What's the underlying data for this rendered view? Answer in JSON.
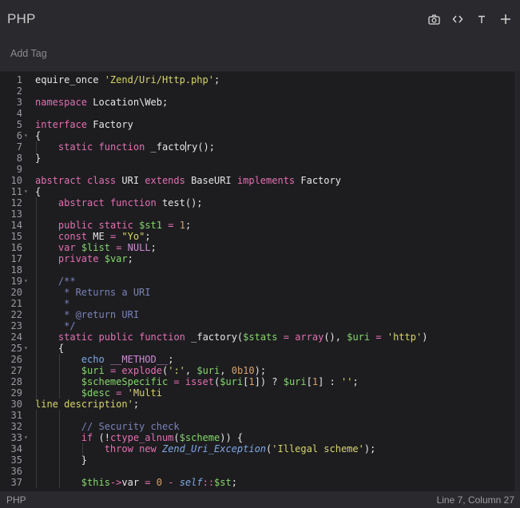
{
  "header": {
    "title": "PHP",
    "icons": [
      "camera-icon",
      "code-brackets-icon",
      "text-format-icon",
      "plus-icon"
    ]
  },
  "tags": {
    "add_label": "Add Tag"
  },
  "colors": {
    "keyword": "#e46fb1",
    "string": "#d7d46c",
    "number": "#d8a06a",
    "variable": "#86d66b",
    "comment": "#7a83b8",
    "magic": "#7fa8e6",
    "constant": "#d08ad6",
    "plain": "#e6e6e6"
  },
  "editor": {
    "lines": [
      {
        "n": "1",
        "fold": false,
        "indent": 0,
        "tokens": [
          [
            "p",
            "equire_once "
          ],
          [
            "s",
            "'Zend/Uri/Http.php'"
          ],
          [
            "p",
            ";"
          ]
        ]
      },
      {
        "n": "2",
        "fold": false,
        "indent": 0,
        "tokens": []
      },
      {
        "n": "3",
        "fold": false,
        "indent": 0,
        "tokens": [
          [
            "k",
            "namespace"
          ],
          [
            "p",
            " Location\\Web;"
          ]
        ]
      },
      {
        "n": "4",
        "fold": false,
        "indent": 0,
        "tokens": []
      },
      {
        "n": "5",
        "fold": false,
        "indent": 0,
        "tokens": [
          [
            "k",
            "interface"
          ],
          [
            "p",
            " Factory"
          ]
        ]
      },
      {
        "n": "6",
        "fold": true,
        "indent": 0,
        "tokens": [
          [
            "p",
            "{"
          ]
        ]
      },
      {
        "n": "7",
        "fold": false,
        "indent": 1,
        "tokens": [
          [
            "p",
            "    "
          ],
          [
            "k",
            "static"
          ],
          [
            "p",
            " "
          ],
          [
            "k",
            "function"
          ],
          [
            "p",
            " _facto"
          ],
          [
            "cursor",
            ""
          ],
          [
            "p",
            "ry();"
          ]
        ]
      },
      {
        "n": "8",
        "fold": false,
        "indent": 0,
        "tokens": [
          [
            "p",
            "}"
          ]
        ]
      },
      {
        "n": "9",
        "fold": false,
        "indent": 0,
        "tokens": []
      },
      {
        "n": "10",
        "fold": false,
        "indent": 0,
        "tokens": [
          [
            "k",
            "abstract"
          ],
          [
            "p",
            " "
          ],
          [
            "k",
            "class"
          ],
          [
            "p",
            " URI "
          ],
          [
            "k",
            "extends"
          ],
          [
            "p",
            " BaseURI "
          ],
          [
            "k",
            "implements"
          ],
          [
            "p",
            " Factory"
          ]
        ]
      },
      {
        "n": "11",
        "fold": true,
        "indent": 0,
        "tokens": [
          [
            "p",
            "{"
          ]
        ]
      },
      {
        "n": "12",
        "fold": false,
        "indent": 1,
        "tokens": [
          [
            "p",
            "    "
          ],
          [
            "k",
            "abstract"
          ],
          [
            "p",
            " "
          ],
          [
            "k",
            "function"
          ],
          [
            "p",
            " test();"
          ]
        ]
      },
      {
        "n": "13",
        "fold": false,
        "indent": 1,
        "tokens": []
      },
      {
        "n": "14",
        "fold": false,
        "indent": 1,
        "tokens": [
          [
            "p",
            "    "
          ],
          [
            "k",
            "public"
          ],
          [
            "p",
            " "
          ],
          [
            "k",
            "static"
          ],
          [
            "p",
            " "
          ],
          [
            "v",
            "$st1"
          ],
          [
            "p",
            " "
          ],
          [
            "k",
            "="
          ],
          [
            "p",
            " "
          ],
          [
            "d",
            "1"
          ],
          [
            "p",
            ";"
          ]
        ]
      },
      {
        "n": "15",
        "fold": false,
        "indent": 1,
        "tokens": [
          [
            "p",
            "    "
          ],
          [
            "k",
            "const"
          ],
          [
            "p",
            " ME "
          ],
          [
            "k",
            "="
          ],
          [
            "p",
            " "
          ],
          [
            "s",
            "\"Yo\""
          ],
          [
            "p",
            ";"
          ]
        ]
      },
      {
        "n": "16",
        "fold": false,
        "indent": 1,
        "tokens": [
          [
            "p",
            "    "
          ],
          [
            "k",
            "var"
          ],
          [
            "p",
            " "
          ],
          [
            "v",
            "$list"
          ],
          [
            "p",
            " "
          ],
          [
            "k",
            "="
          ],
          [
            "p",
            " "
          ],
          [
            "c",
            "NULL"
          ],
          [
            "p",
            ";"
          ]
        ]
      },
      {
        "n": "17",
        "fold": false,
        "indent": 1,
        "tokens": [
          [
            "p",
            "    "
          ],
          [
            "k",
            "private"
          ],
          [
            "p",
            " "
          ],
          [
            "v",
            "$var"
          ],
          [
            "p",
            ";"
          ]
        ]
      },
      {
        "n": "18",
        "fold": false,
        "indent": 1,
        "tokens": []
      },
      {
        "n": "19",
        "fold": true,
        "indent": 1,
        "tokens": [
          [
            "p",
            "    "
          ],
          [
            "m",
            "/**"
          ]
        ]
      },
      {
        "n": "20",
        "fold": false,
        "indent": 1,
        "tokens": [
          [
            "p",
            "    "
          ],
          [
            "m",
            " * Returns a URI"
          ]
        ]
      },
      {
        "n": "21",
        "fold": false,
        "indent": 1,
        "tokens": [
          [
            "p",
            "    "
          ],
          [
            "m",
            " *"
          ]
        ]
      },
      {
        "n": "22",
        "fold": false,
        "indent": 1,
        "tokens": [
          [
            "p",
            "    "
          ],
          [
            "m",
            " * @return URI"
          ]
        ]
      },
      {
        "n": "23",
        "fold": false,
        "indent": 1,
        "tokens": [
          [
            "p",
            "    "
          ],
          [
            "m",
            " */"
          ]
        ]
      },
      {
        "n": "24",
        "fold": false,
        "indent": 1,
        "tokens": [
          [
            "p",
            "    "
          ],
          [
            "k",
            "static"
          ],
          [
            "p",
            " "
          ],
          [
            "k",
            "public"
          ],
          [
            "p",
            " "
          ],
          [
            "k",
            "function"
          ],
          [
            "p",
            " _factory("
          ],
          [
            "v",
            "$stats"
          ],
          [
            "p",
            " "
          ],
          [
            "k",
            "="
          ],
          [
            "p",
            " "
          ],
          [
            "k",
            "array"
          ],
          [
            "p",
            "(), "
          ],
          [
            "v",
            "$uri"
          ],
          [
            "p",
            " "
          ],
          [
            "k",
            "="
          ],
          [
            "p",
            " "
          ],
          [
            "s",
            "'http'"
          ],
          [
            "p",
            ")"
          ]
        ]
      },
      {
        "n": "25",
        "fold": true,
        "indent": 1,
        "tokens": [
          [
            "p",
            "    {"
          ]
        ]
      },
      {
        "n": "26",
        "fold": false,
        "indent": 2,
        "tokens": [
          [
            "p",
            "        "
          ],
          [
            "g",
            "echo"
          ],
          [
            "p",
            " "
          ],
          [
            "c",
            "__METHOD__"
          ],
          [
            "p",
            ";"
          ]
        ]
      },
      {
        "n": "27",
        "fold": false,
        "indent": 2,
        "tokens": [
          [
            "p",
            "        "
          ],
          [
            "v",
            "$uri"
          ],
          [
            "p",
            " "
          ],
          [
            "k",
            "="
          ],
          [
            "p",
            " "
          ],
          [
            "k",
            "explode"
          ],
          [
            "p",
            "("
          ],
          [
            "s",
            "':'"
          ],
          [
            "p",
            ", "
          ],
          [
            "v",
            "$uri"
          ],
          [
            "p",
            ", "
          ],
          [
            "d",
            "0b10"
          ],
          [
            "p",
            ");"
          ]
        ]
      },
      {
        "n": "28",
        "fold": false,
        "indent": 2,
        "tokens": [
          [
            "p",
            "        "
          ],
          [
            "v",
            "$schemeSpecific"
          ],
          [
            "p",
            " "
          ],
          [
            "k",
            "="
          ],
          [
            "p",
            " "
          ],
          [
            "k",
            "isset"
          ],
          [
            "p",
            "("
          ],
          [
            "v",
            "$uri"
          ],
          [
            "p",
            "["
          ],
          [
            "d",
            "1"
          ],
          [
            "p",
            "]) ? "
          ],
          [
            "v",
            "$uri"
          ],
          [
            "p",
            "["
          ],
          [
            "d",
            "1"
          ],
          [
            "p",
            "] : "
          ],
          [
            "s",
            "''"
          ],
          [
            "p",
            ";"
          ]
        ]
      },
      {
        "n": "29",
        "fold": false,
        "indent": 2,
        "tokens": [
          [
            "p",
            "        "
          ],
          [
            "v",
            "$desc"
          ],
          [
            "p",
            " "
          ],
          [
            "k",
            "="
          ],
          [
            "p",
            " "
          ],
          [
            "s",
            "'Multi"
          ]
        ]
      },
      {
        "n": "30",
        "fold": false,
        "indent": 0,
        "tokens": [
          [
            "s",
            "line description'"
          ],
          [
            "p",
            ";"
          ]
        ]
      },
      {
        "n": "31",
        "fold": false,
        "indent": 2,
        "tokens": []
      },
      {
        "n": "32",
        "fold": false,
        "indent": 2,
        "tokens": [
          [
            "p",
            "        "
          ],
          [
            "m",
            "// Security check"
          ]
        ]
      },
      {
        "n": "33",
        "fold": true,
        "indent": 2,
        "tokens": [
          [
            "p",
            "        "
          ],
          [
            "k",
            "if"
          ],
          [
            "p",
            " (!"
          ],
          [
            "k",
            "ctype_alnum"
          ],
          [
            "p",
            "("
          ],
          [
            "v",
            "$scheme"
          ],
          [
            "p",
            ")) {"
          ]
        ]
      },
      {
        "n": "34",
        "fold": false,
        "indent": 3,
        "tokens": [
          [
            "p",
            "            "
          ],
          [
            "k",
            "throw"
          ],
          [
            "p",
            " "
          ],
          [
            "k",
            "new"
          ],
          [
            "p",
            " "
          ],
          [
            "i",
            "Zend_Uri_Exception"
          ],
          [
            "p",
            "("
          ],
          [
            "s",
            "'Illegal scheme'"
          ],
          [
            "p",
            ");"
          ]
        ]
      },
      {
        "n": "35",
        "fold": false,
        "indent": 2,
        "tokens": [
          [
            "p",
            "        }"
          ]
        ]
      },
      {
        "n": "36",
        "fold": false,
        "indent": 2,
        "tokens": []
      },
      {
        "n": "37",
        "fold": false,
        "indent": 2,
        "tokens": [
          [
            "p",
            "        "
          ],
          [
            "v",
            "$this"
          ],
          [
            "k",
            "->"
          ],
          [
            "p",
            "var "
          ],
          [
            "k",
            "="
          ],
          [
            "p",
            " "
          ],
          [
            "d",
            "0"
          ],
          [
            "p",
            " "
          ],
          [
            "k",
            "-"
          ],
          [
            "p",
            " "
          ],
          [
            "i",
            "self"
          ],
          [
            "k",
            "::"
          ],
          [
            "v",
            "$st"
          ],
          [
            "p",
            ";"
          ]
        ]
      }
    ]
  },
  "status": {
    "language": "PHP",
    "position": "Line 7, Column 27"
  }
}
